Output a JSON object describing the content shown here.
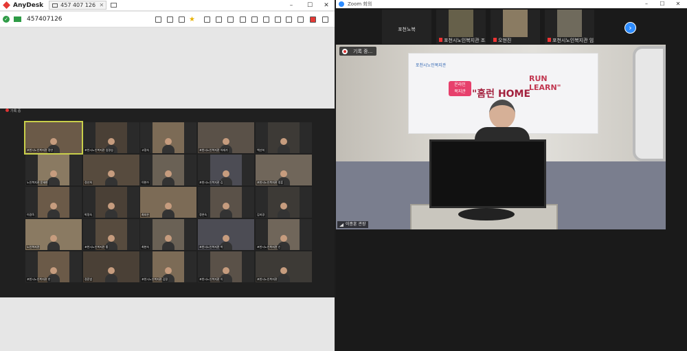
{
  "anydesk": {
    "app_name": "AnyDesk",
    "tab_address": "457 407 126",
    "address_bar": "457407126",
    "window_controls": [
      "minimize",
      "maximize",
      "close"
    ],
    "toolbar_icons": [
      "chat-icon",
      "timer-icon",
      "database-icon",
      "star-icon",
      "file-transfer-icon",
      "display-icon",
      "monitor-icon",
      "monitor-icon",
      "whiteboard-icon",
      "bolt-icon",
      "keyboard-icon",
      "monitor-icon",
      "shield-icon",
      "record-icon",
      "menu-icon"
    ]
  },
  "remote": {
    "header_label": "기록 중",
    "tiles": [
      {
        "name": "포천시노인복지관 정연"
      },
      {
        "name": "포천시노인복지관 임명섭"
      },
      {
        "name": "고정숙"
      },
      {
        "name": "포천시노인복지관 이래가"
      },
      {
        "name": "백선희"
      },
      {
        "name": "노인복지관 문세현"
      },
      {
        "name": "정선희"
      },
      {
        "name": "이현수"
      },
      {
        "name": "포천시노인복지관 김"
      },
      {
        "name": "포천시노인복지관 정훈"
      },
      {
        "name": "이경옥"
      },
      {
        "name": "박정숙"
      },
      {
        "name": "최지은"
      },
      {
        "name": "정연숙"
      },
      {
        "name": "김미경"
      },
      {
        "name": "노인복지관"
      },
      {
        "name": "포천시노인복지관 홍"
      },
      {
        "name": "최현숙"
      },
      {
        "name": "포천시노인복지관 박"
      },
      {
        "name": "포천시노인복지관 신"
      },
      {
        "name": "포천시노인복지관 한"
      },
      {
        "name": "정준범"
      },
      {
        "name": "포천시노인복지관 김정"
      },
      {
        "name": "포천시노인복지관 이"
      },
      {
        "name": "포천시노인복지관"
      }
    ]
  },
  "zoom": {
    "window_title": "Zoom 회의",
    "thumbnails": [
      {
        "name": "포천노복",
        "has_video": false,
        "muted": false
      },
      {
        "name": "포천시노인복지관 조...",
        "has_video": true,
        "muted": true
      },
      {
        "name": "오현진",
        "has_video": true,
        "muted": true
      },
      {
        "name": "포천시노인복지관 임...",
        "has_video": true,
        "muted": true
      }
    ],
    "next_label": "›",
    "recording_label": "기록 중...",
    "speaker_name": "이종훈 관장",
    "banner": {
      "org": "포천시노인복지관",
      "tag_line1": "온라인",
      "tag_line2": "복지관",
      "title_hong": "\"홈런",
      "title_home": "HOME",
      "title_run": "RUN",
      "title_learn": "LEARN\""
    }
  },
  "colors": {
    "anydesk_red": "#e53935",
    "zoom_blue": "#2d8cff",
    "connected_green": "#2e9b46"
  }
}
